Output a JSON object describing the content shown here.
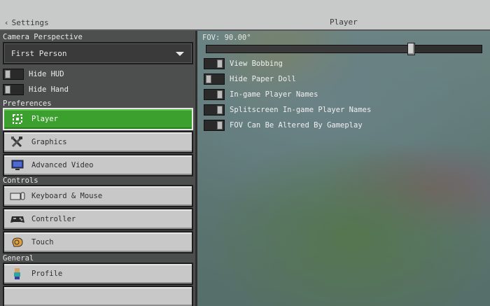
{
  "header": {
    "back_label": "Settings",
    "title": "Player"
  },
  "left": {
    "camera_perspective": {
      "label": "Camera Perspective",
      "value": "First Person"
    },
    "toggles": [
      {
        "label": "Hide HUD",
        "on": false
      },
      {
        "label": "Hide Hand",
        "on": false
      }
    ],
    "sections": {
      "preferences": "Preferences",
      "controls": "Controls",
      "general": "General"
    },
    "preferences_items": [
      {
        "label": "Player",
        "icon": "player-icon",
        "active": true
      },
      {
        "label": "Graphics",
        "icon": "graphics-icon",
        "active": false
      },
      {
        "label": "Advanced Video",
        "icon": "monitor-icon",
        "active": false
      }
    ],
    "controls_items": [
      {
        "label": "Keyboard & Mouse",
        "icon": "keyboard-icon"
      },
      {
        "label": "Controller",
        "icon": "controller-icon"
      },
      {
        "label": "Touch",
        "icon": "touch-icon"
      }
    ],
    "general_items": [
      {
        "label": "Profile",
        "icon": "profile-icon"
      }
    ]
  },
  "right": {
    "fov": {
      "label": "FOV: 90.00°",
      "value": 90.0,
      "min": 30,
      "max": 110
    },
    "options": [
      {
        "label": "View Bobbing",
        "on": false
      },
      {
        "label": "Hide Paper Doll",
        "on": false
      },
      {
        "label": "In-game Player Names",
        "on": false
      },
      {
        "label": "Splitscreen In-game Player Names",
        "on": false
      },
      {
        "label": "FOV Can Be Altered By Gameplay",
        "on": false
      }
    ]
  },
  "colors": {
    "active_green": "#3ca02f",
    "panel_dark": "#4a4a4a",
    "button_light": "#c8c8c8"
  }
}
